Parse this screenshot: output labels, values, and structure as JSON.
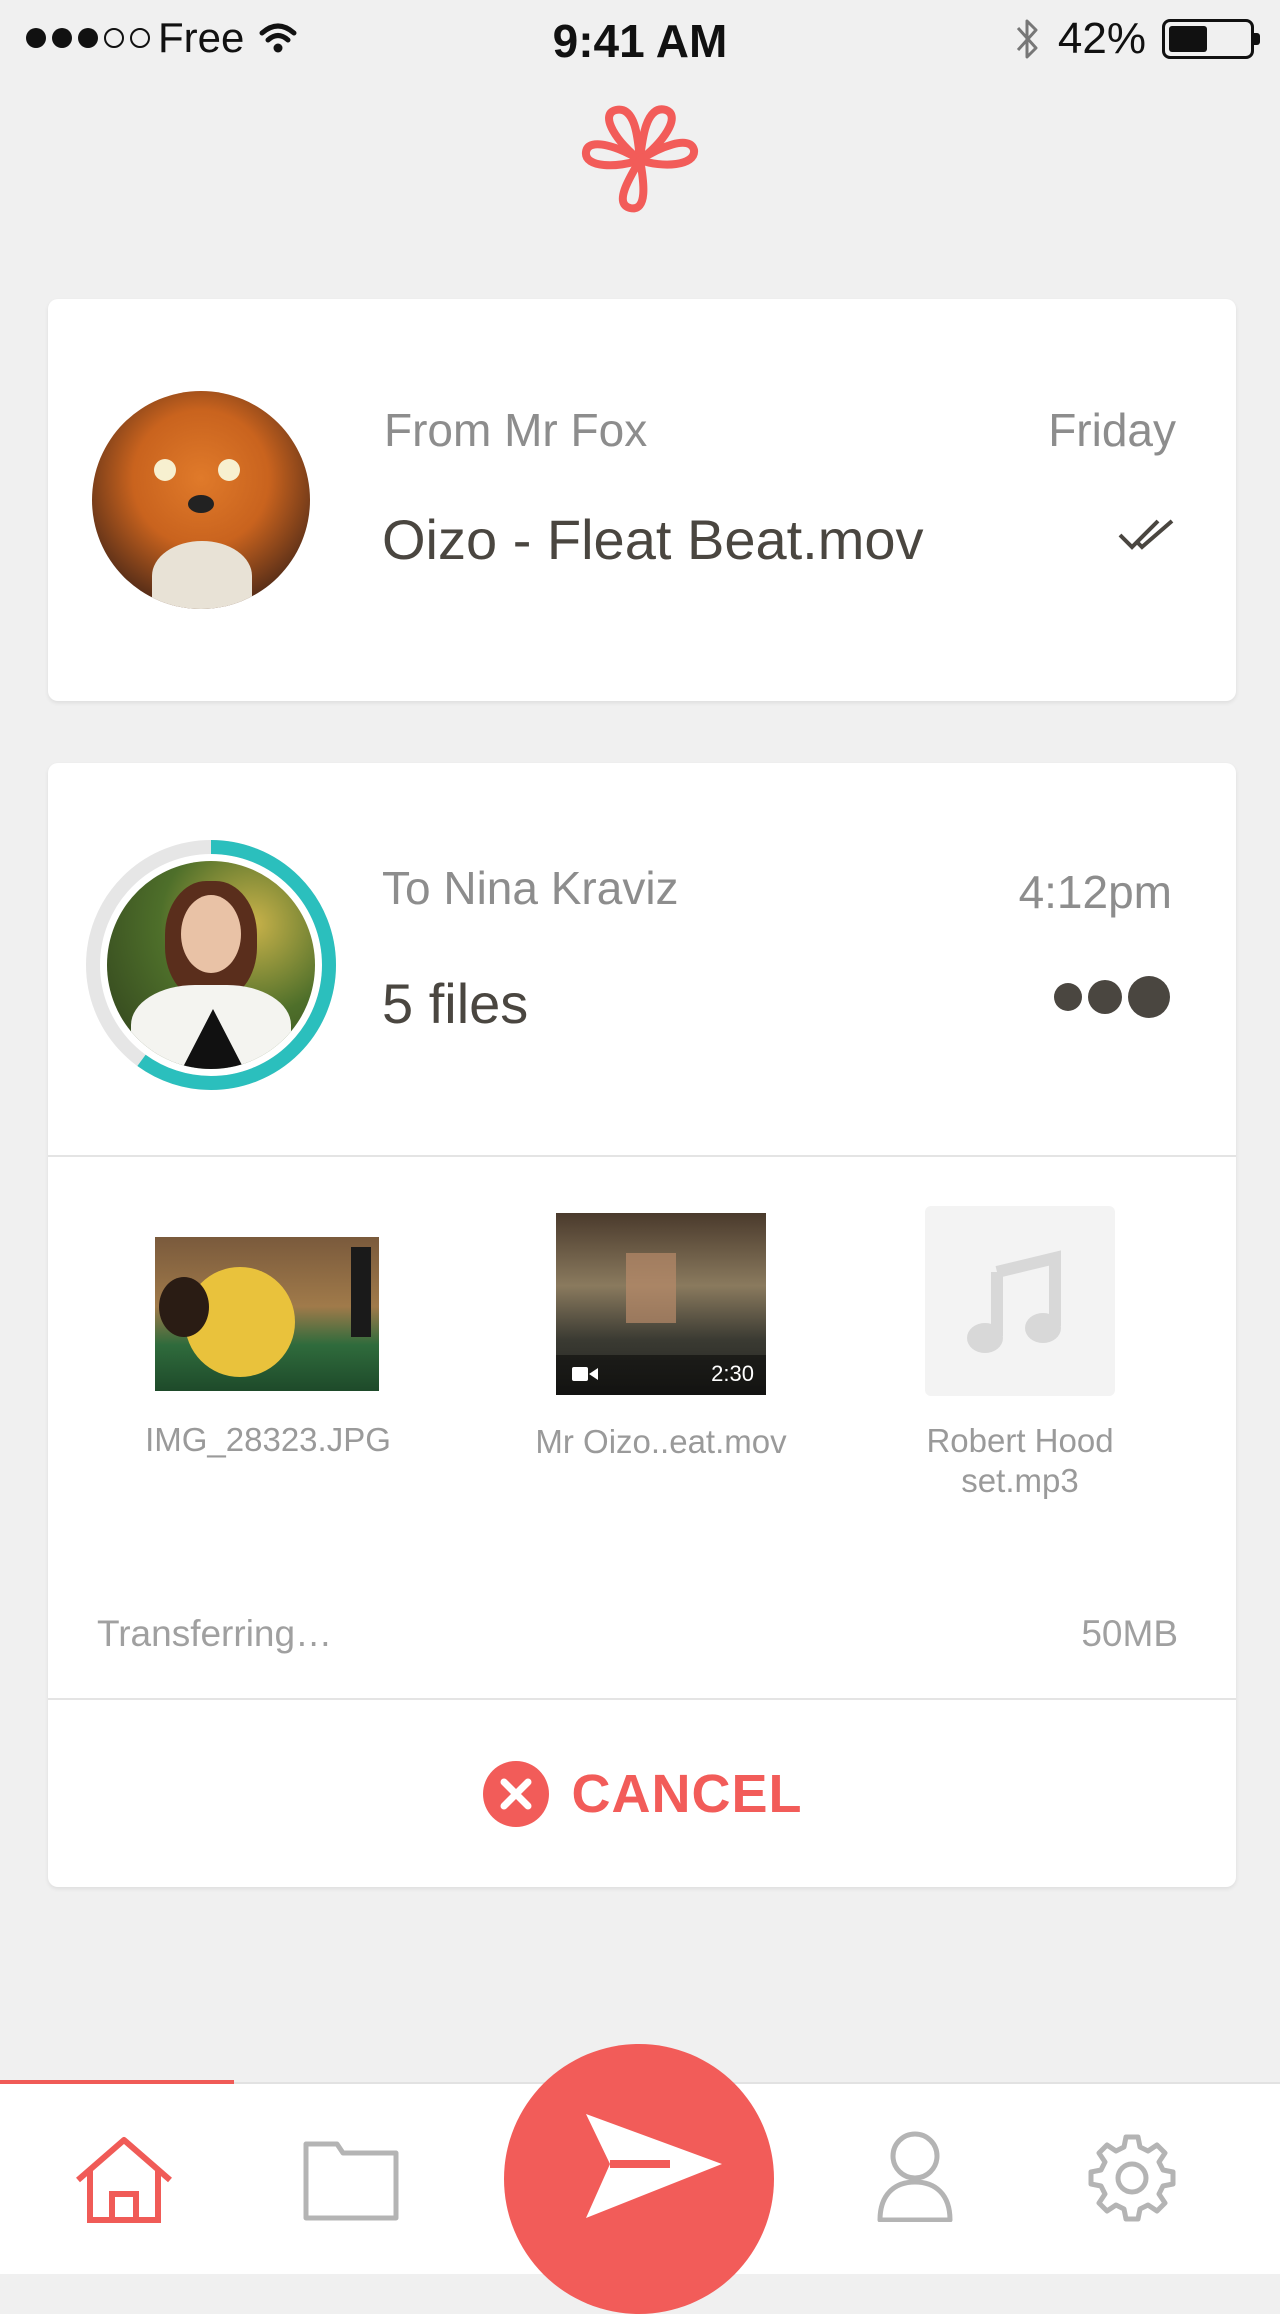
{
  "status_bar": {
    "carrier": "Free",
    "signal_bars": 5,
    "signal_filled": 3,
    "time": "9:41 AM",
    "battery_percent": "42%",
    "battery_level": 0.42,
    "icons": [
      "wifi-icon",
      "bluetooth-icon",
      "battery-icon"
    ]
  },
  "app": {
    "logo_icon": "clover-logo-icon",
    "accent_color": "#f25c59",
    "progress_color": "#2bbfbd"
  },
  "transfers": [
    {
      "direction_label": "From Mr Fox",
      "title": "Oizo - Fleat Beat.mov",
      "time": "Friday",
      "status_icon": "double-check-icon"
    },
    {
      "direction_label": "To Nina Kraviz",
      "title": "5 files",
      "time": "4:12pm",
      "status_icon": "typing-dots-icon",
      "progress": 0.6,
      "files": [
        {
          "name": "IMG_28323.JPG",
          "type": "image"
        },
        {
          "name": "Mr Oizo..eat.mov",
          "type": "video",
          "duration": "2:30"
        },
        {
          "name": "Robert Hood set.mp3",
          "type": "audio"
        }
      ],
      "status_text": "Transferring…",
      "size": "50MB",
      "cancel_label": "CANCEL"
    }
  ],
  "nav": {
    "items": [
      "home-icon",
      "folder-icon",
      "send-icon",
      "profile-icon",
      "settings-icon"
    ],
    "active": "home-icon"
  }
}
